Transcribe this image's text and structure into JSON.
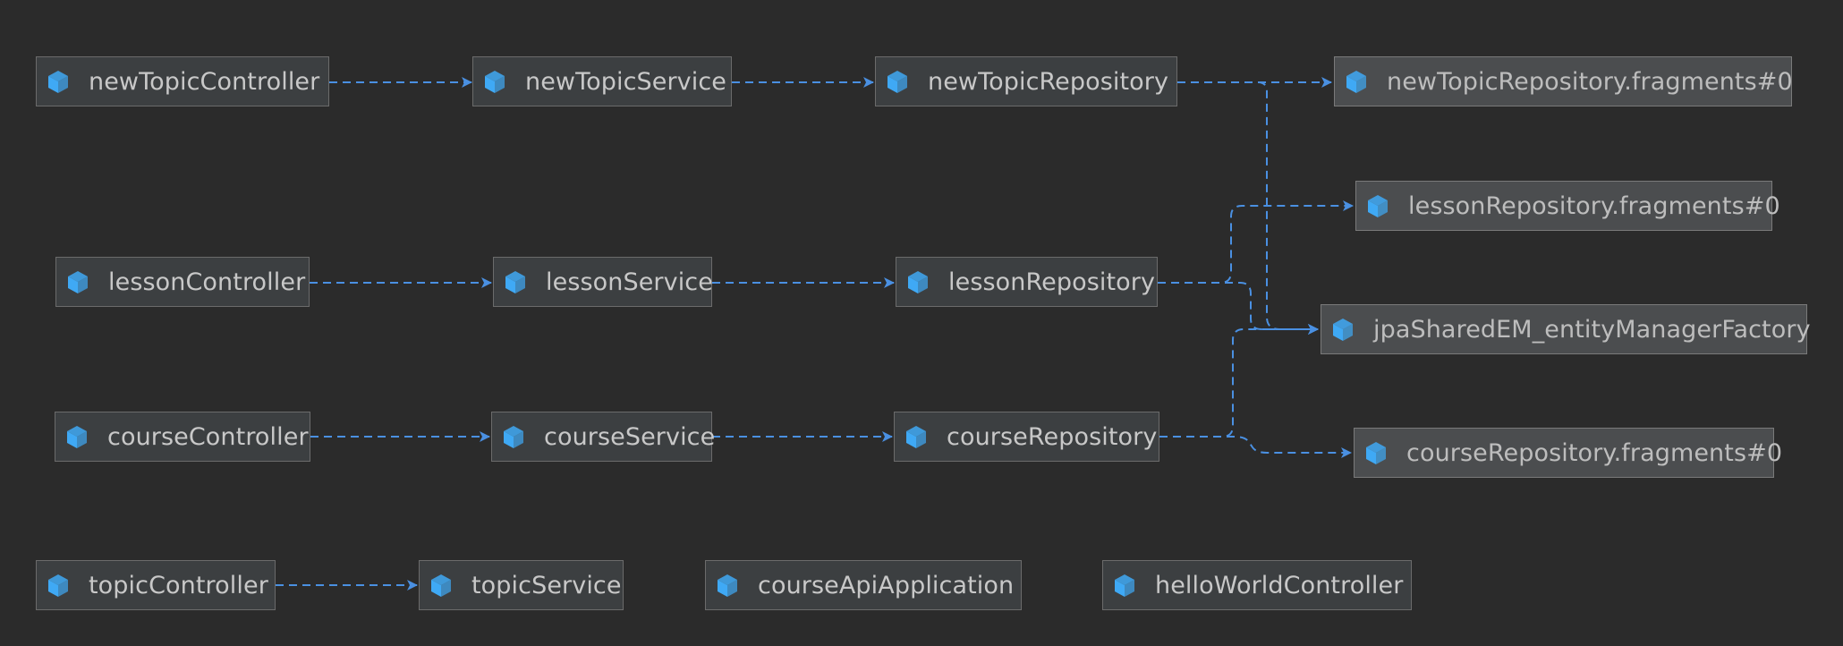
{
  "colors": {
    "background": "#2b2b2b",
    "node_fill": "#3c3f41",
    "node_fill_light": "#4b4d4f",
    "node_border": "#6b6b6b",
    "label": "#c8c8c8",
    "edge": "#4a90e2",
    "bean_icon": "#3fa9f5"
  },
  "icon": "spring-bean-cube-icon",
  "nodes": {
    "newTopicController": "newTopicController",
    "newTopicService": "newTopicService",
    "newTopicRepository": "newTopicRepository",
    "newTopicRepositoryFragments": "newTopicRepository.fragments#0",
    "lessonRepositoryFragments": "lessonRepository.fragments#0",
    "lessonController": "lessonController",
    "lessonService": "lessonService",
    "lessonRepository": "lessonRepository",
    "jpaSharedEM": "jpaSharedEM_entityManagerFactory",
    "courseController": "courseController",
    "courseService": "courseService",
    "courseRepository": "courseRepository",
    "courseRepositoryFragments": "courseRepository.fragments#0",
    "topicController": "topicController",
    "topicService": "topicService",
    "courseApiApplication": "courseApiApplication",
    "helloWorldController": "helloWorldController"
  },
  "edges": [
    {
      "from": "newTopicController",
      "to": "newTopicService"
    },
    {
      "from": "newTopicService",
      "to": "newTopicRepository"
    },
    {
      "from": "newTopicRepository",
      "to": "newTopicRepositoryFragments"
    },
    {
      "from": "newTopicRepository",
      "to": "jpaSharedEM"
    },
    {
      "from": "lessonController",
      "to": "lessonService"
    },
    {
      "from": "lessonService",
      "to": "lessonRepository"
    },
    {
      "from": "lessonRepository",
      "to": "lessonRepositoryFragments"
    },
    {
      "from": "lessonRepository",
      "to": "jpaSharedEM"
    },
    {
      "from": "courseController",
      "to": "courseService"
    },
    {
      "from": "courseService",
      "to": "courseRepository"
    },
    {
      "from": "courseRepository",
      "to": "jpaSharedEM"
    },
    {
      "from": "courseRepository",
      "to": "courseRepositoryFragments"
    },
    {
      "from": "topicController",
      "to": "topicService"
    }
  ]
}
